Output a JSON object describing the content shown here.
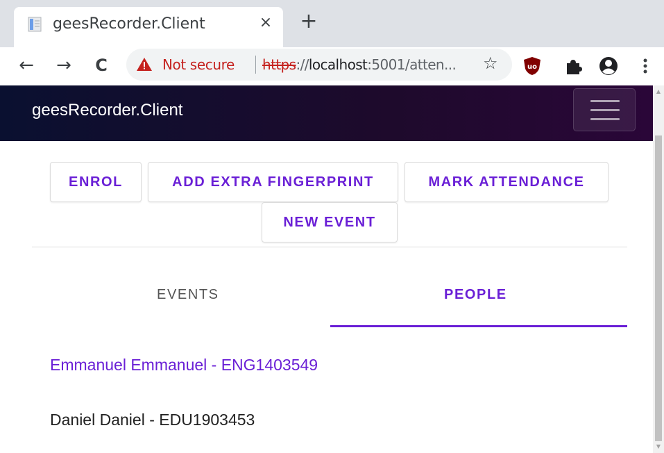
{
  "browser": {
    "tab_title": "geesRecorder.Client",
    "tab_close": "×",
    "new_tab": "+",
    "back_icon": "←",
    "forward_icon": "→",
    "reload_icon": "C",
    "security_label": "Not secure",
    "url_scheme": "https",
    "url_rest_before_host": "://",
    "url_host": "localhost",
    "url_path": ":5001/atten...",
    "bookmark_icon": "☆",
    "security_color": "#c5221f"
  },
  "app": {
    "brand": "geesRecorder.Client",
    "accent_color": "#6a1fd6",
    "actions": {
      "enrol": "ENROL",
      "add_extra_fingerprint": "ADD EXTRA FINGERPRINT",
      "mark_attendance": "MARK ATTENDANCE",
      "new_event": "NEW EVENT"
    },
    "tabs": [
      {
        "label": "EVENTS",
        "selected": false
      },
      {
        "label": "PEOPLE",
        "selected": true
      }
    ],
    "people": [
      {
        "label": "Emmanuel Emmanuel - ENG1403549",
        "highlighted": true
      },
      {
        "label": "Daniel Daniel - EDU1903453",
        "highlighted": false
      }
    ]
  },
  "icons": {
    "tab_favicon": "page-icon",
    "omnibox_warning": "warning-triangle-icon",
    "extension_1": "ublock-shield-icon",
    "extension_2": "puzzle-piece-icon",
    "profile": "account-circle-icon",
    "menu": "kebab-menu-icon",
    "navbar_toggle": "hamburger-icon"
  }
}
